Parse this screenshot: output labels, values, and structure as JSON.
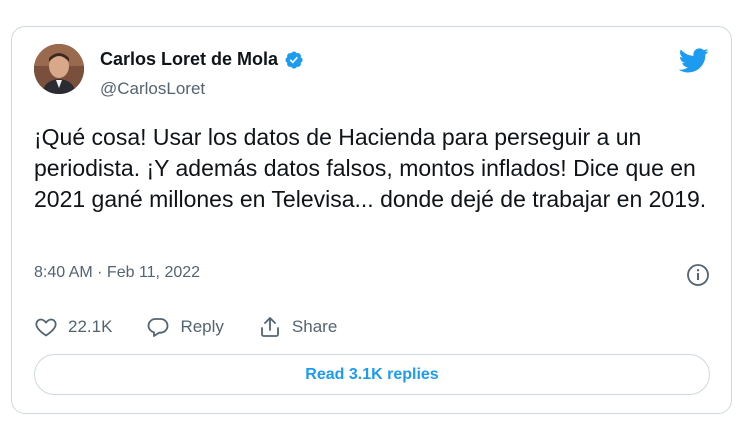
{
  "author": {
    "display_name": "Carlos Loret de Mola",
    "handle": "@CarlosLoret",
    "verified": true
  },
  "tweet": {
    "text": "¡Qué cosa! Usar los datos de Hacienda para perseguir a un periodista. ¡Y además datos falsos, montos inflados! Dice que en 2021 gané millones en Televisa... donde dejé de trabajar en 2019.",
    "timestamp": "8:40 AM · Feb 11, 2022"
  },
  "actions": {
    "like_count": "22.1K",
    "reply_label": "Reply",
    "share_label": "Share"
  },
  "read_replies_label": "Read 3.1K replies",
  "colors": {
    "brand": "#1d9bf0",
    "text": "#0f1419",
    "secondary": "#536471",
    "border": "#cfd9de"
  },
  "icons": [
    "verified-badge-icon",
    "twitter-bird-icon",
    "info-icon",
    "heart-icon",
    "reply-icon",
    "share-icon"
  ]
}
